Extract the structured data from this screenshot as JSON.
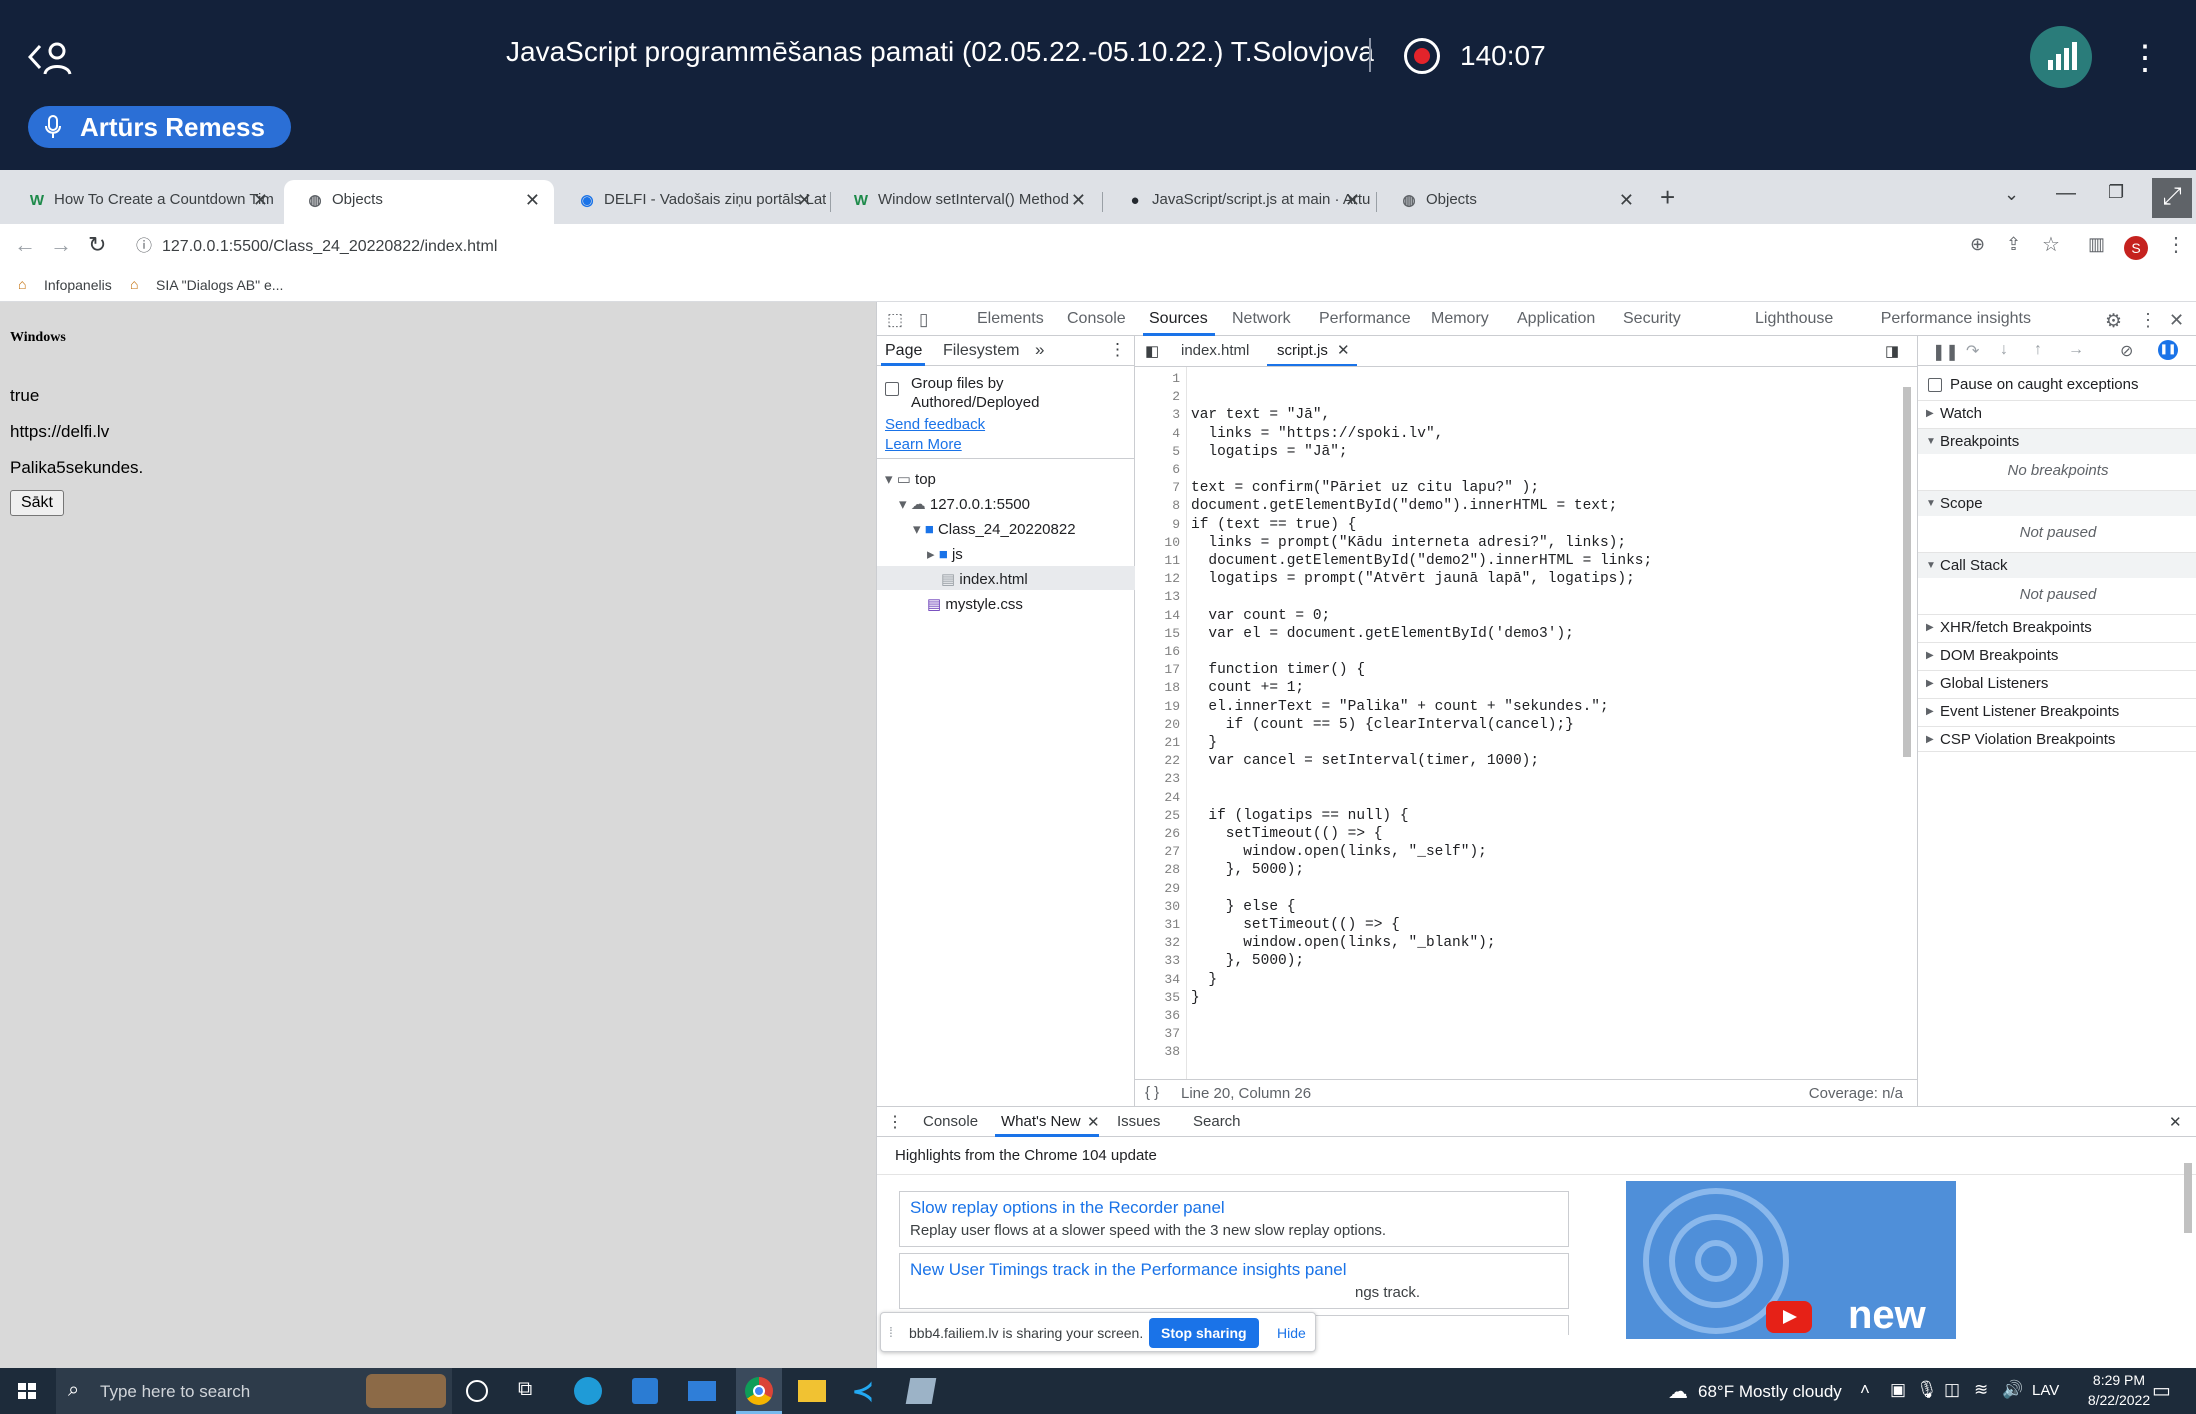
{
  "meeting": {
    "title": "JavaScript programmēšanas pamati (02.05.22.-05.10.22.) T.Solovjova",
    "recording_time": "140:07",
    "speaker": "Artūrs Remess"
  },
  "browser": {
    "tabs": [
      {
        "label": "How To Create a Countdown Tim",
        "icon": "W"
      },
      {
        "label": "Objects",
        "icon": "globe-icon",
        "active": true
      },
      {
        "label": "DELFI - Vadošais ziņu portāls Lat",
        "icon": "delfi-icon"
      },
      {
        "label": "Window setInterval() Method",
        "icon": "W"
      },
      {
        "label": "JavaScript/script.js at main · Artu",
        "icon": "github-icon"
      },
      {
        "label": "Objects",
        "icon": "globe-icon"
      }
    ],
    "url": "127.0.0.1:5500/Class_24_20220822/index.html",
    "profile_letter": "S",
    "bookmarks": [
      "Infopanelis",
      "SIA \"Dialogs AB\" e..."
    ]
  },
  "page": {
    "heading": "Windows",
    "lines": [
      "true",
      "https://delfi.lv",
      "Palika5sekundes."
    ],
    "button": "Sākt"
  },
  "devtools": {
    "tabs": [
      "Elements",
      "Console",
      "Sources",
      "Network",
      "Performance",
      "Memory",
      "Application",
      "Security",
      "Lighthouse",
      "Performance insights"
    ],
    "active_tab": "Sources",
    "nav_tabs": [
      "Page",
      "Filesystem"
    ],
    "group_files": "Group files by Authored/Deployed",
    "send_feedback": "Send feedback",
    "learn_more": "Learn More",
    "tree": [
      "top",
      "127.0.0.1:5500",
      "Class_24_20220822",
      "js",
      "index.html",
      "mystyle.css"
    ],
    "editor_tabs": [
      "index.html",
      "script.js"
    ],
    "code_lines": [
      "",
      "",
      "var text = \"Jā\",",
      "  links = \"https://spoki.lv\",",
      "  logatips = \"Jā\";",
      "",
      "text = confirm(\"Pāriet uz citu lapu?\" );",
      "document.getElementById(\"demo\").innerHTML = text;",
      "if (text == true) {",
      "  links = prompt(\"Kādu interneta adresi?\", links);",
      "  document.getElementById(\"demo2\").innerHTML = links;",
      "  logatips = prompt(\"Atvērt jaunā lapā\", logatips);",
      "",
      "  var count = 0;",
      "  var el = document.getElementById('demo3');",
      "",
      "  function timer() {",
      "  count += 1;",
      "  el.innerText = \"Palika\" + count + \"sekundes.\";",
      "    if (count == 5) {clearInterval(cancel);}",
      "  }",
      "  var cancel = setInterval(timer, 1000);",
      "",
      "",
      "  if (logatips == null) {",
      "    setTimeout(() => {",
      "      window.open(links, \"_self\");",
      "    }, 5000);",
      "",
      "    } else {",
      "      setTimeout(() => {",
      "      window.open(links, \"_blank\");",
      "    }, 5000);",
      "  }",
      "}",
      "",
      "",
      ""
    ],
    "status_position": "Line 20, Column 26",
    "coverage": "Coverage: n/a",
    "pause_on_caught": "Pause on caught exceptions",
    "debugger_sections": [
      "Watch",
      "Breakpoints",
      "Scope",
      "Call Stack",
      "XHR/fetch Breakpoints",
      "DOM Breakpoints",
      "Global Listeners",
      "Event Listener Breakpoints",
      "CSP Violation Breakpoints"
    ],
    "no_breakpoints": "No breakpoints",
    "not_paused": "Not paused",
    "drawer_tabs": [
      "Console",
      "What's New",
      "Issues",
      "Search"
    ],
    "drawer_active": "What's New",
    "highlights": "Highlights from the Chrome 104 update",
    "cards": [
      {
        "title": "Slow replay options in the Recorder panel",
        "desc": "Replay user flows at a slower speed with the 3 new slow replay options."
      },
      {
        "title": "New User Timings track in the Performance insights panel",
        "desc": "ngs track."
      }
    ],
    "video_text": "new"
  },
  "share_banner": {
    "text": "bbb4.failiem.lv is sharing your screen.",
    "stop": "Stop sharing",
    "hide": "Hide"
  },
  "taskbar": {
    "search_placeholder": "Type here to search",
    "weather": "68°F  Mostly cloudy",
    "lang": "LAV",
    "time": "8:29 PM",
    "date": "8/22/2022"
  },
  "colors": {
    "meeting_bg": "#13213a",
    "speaker_pill": "#2b6fd6",
    "devtools_accent": "#1a73e8",
    "page_bg": "#d9d9d9"
  }
}
